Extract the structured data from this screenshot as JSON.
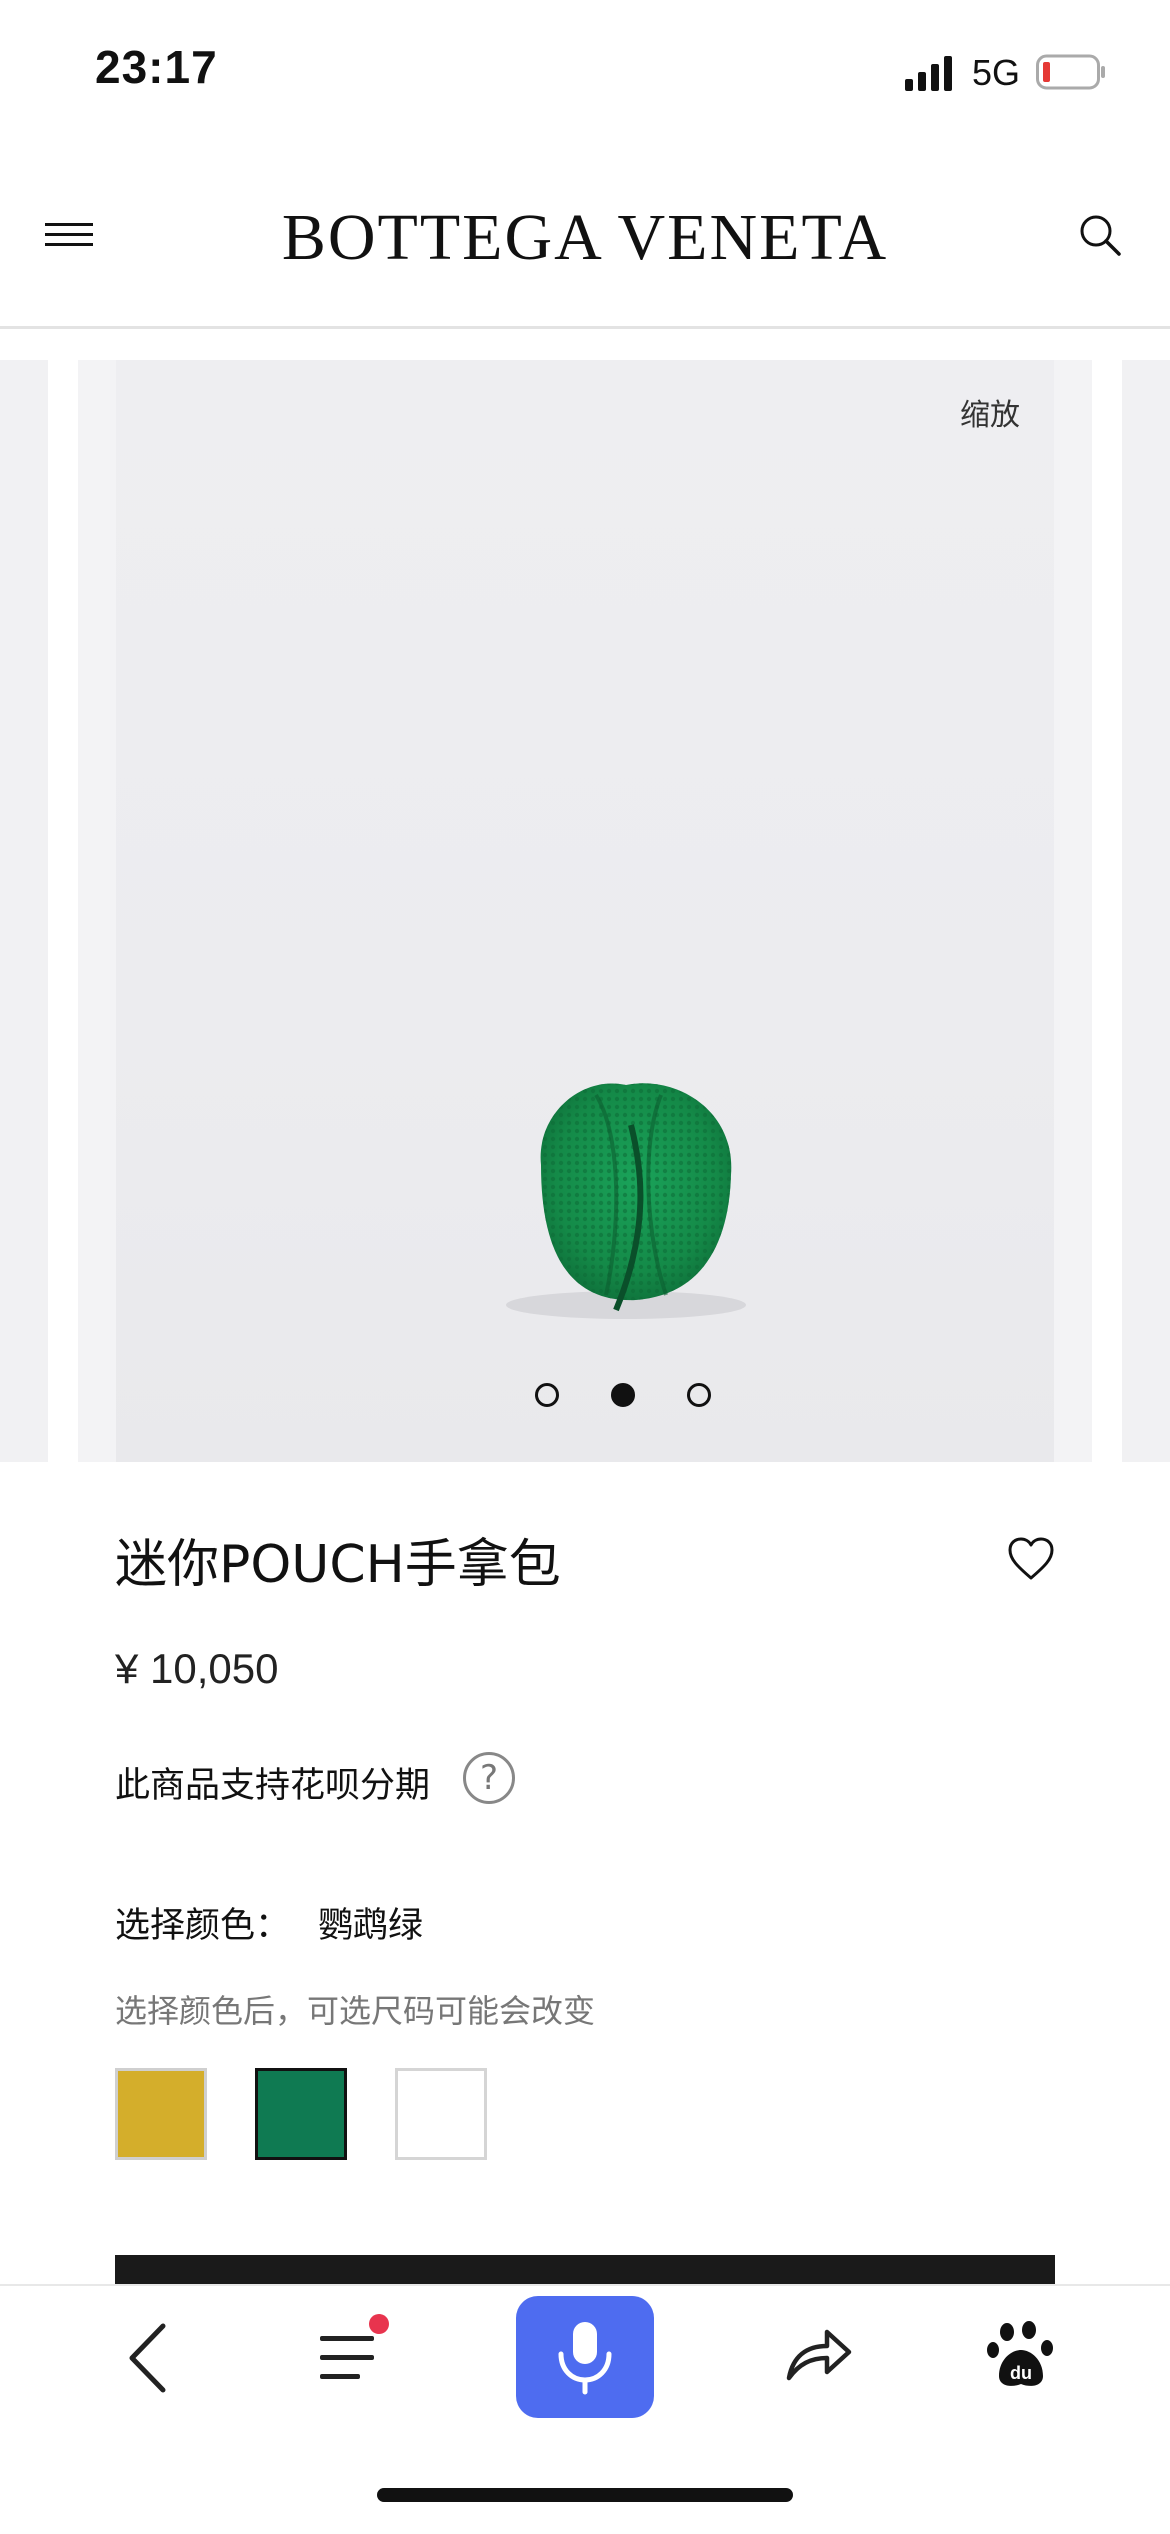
{
  "status_bar": {
    "time": "23:17",
    "network": "5G"
  },
  "header": {
    "brand": "BOTTEGA VENETA"
  },
  "gallery": {
    "zoom_label": "缩放",
    "slide_count": 3,
    "active_slide": 2
  },
  "product": {
    "title": "迷你POUCH手拿包",
    "price": "¥ 10,050",
    "installment_note": "此商品支持花呗分期",
    "help_symbol": "?",
    "color_label": "选择颜色：",
    "selected_color": "鹦鹉绿",
    "color_hint": "选择颜色后，可选尺码可能会改变",
    "swatches": [
      {
        "color": "#d4ae2b"
      },
      {
        "color": "#0f7a52",
        "selected": true
      },
      {
        "color": "#ffffff"
      }
    ]
  },
  "bottom_bar": {
    "icons": [
      "back-icon",
      "menu-list-icon",
      "microphone-icon",
      "share-icon",
      "paw-icon"
    ],
    "accent": "#4e6cf0",
    "badge_color": "#e8344e"
  }
}
